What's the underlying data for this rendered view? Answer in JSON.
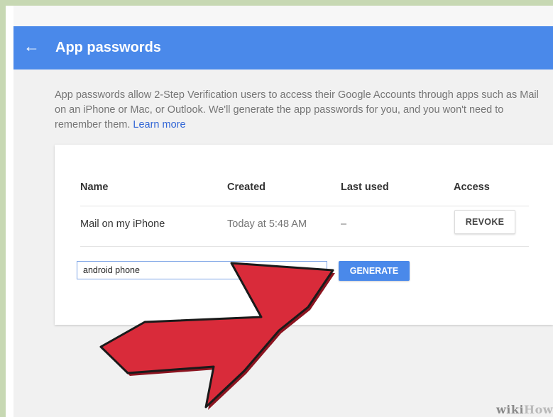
{
  "header": {
    "back_icon": "arrow-left-icon",
    "title": "App passwords",
    "color": "#4a89ea"
  },
  "description": {
    "text": "App passwords allow 2-Step Verification users to access their Google Accounts through apps such as Mail on an iPhone or Mac, or Outlook. We'll generate the app passwords for you, and you won't need to remember them.",
    "link": "Learn more",
    "link_color": "#3367d6"
  },
  "table": {
    "columns": [
      "Name",
      "Created",
      "Last used",
      "Access"
    ],
    "rows": [
      {
        "name": "Mail on my iPhone",
        "created": "Today at 5:48 AM",
        "last_used": "–",
        "action": "REVOKE"
      }
    ]
  },
  "generator": {
    "input_value": "android phone",
    "button_label": "GENERATE"
  },
  "overlay": {
    "arrow_color": "#d92b3a",
    "arrow_icon": "red-pointer-arrow"
  },
  "watermark": {
    "part1": "wiki",
    "part2": "How"
  }
}
